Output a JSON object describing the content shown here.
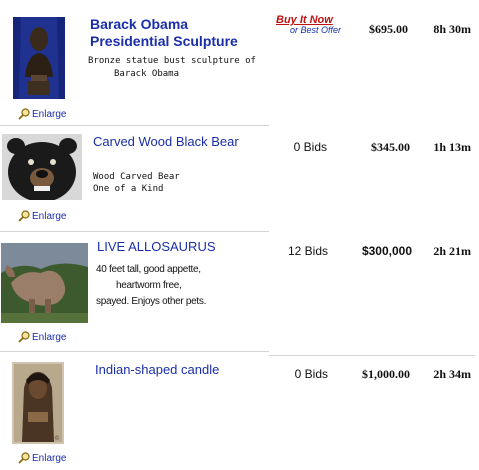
{
  "colors": {
    "link": "#1a2ea8",
    "buy_it_now": "#c01010",
    "divider": "#d4d4d4"
  },
  "listings": [
    {
      "title": "Barack Obama Presidential Sculpture",
      "description_lines": [
        "Bronze statue bust sculpture of",
        "Barack Obama"
      ],
      "format_badge": {
        "main": "Buy It Now",
        "sub": "or Best Offer"
      },
      "bids": "",
      "price": "$695.00",
      "time_left": "8h 30m",
      "enlarge": "Enlarge",
      "image_icon": "bust-photo"
    },
    {
      "title": "Carved Wood Black Bear",
      "description_lines": [
        "Wood Carved Bear",
        "One of a Kind"
      ],
      "bids": "0 Bids",
      "price": "$345.00",
      "time_left": "1h 13m",
      "enlarge": "Enlarge",
      "image_icon": "bear-photo"
    },
    {
      "title": "LIVE ALLOSAURUS",
      "description_lines": [
        "40 feet tall, good appette,",
        "heartworm free,",
        "spayed.  Enjoys other pets."
      ],
      "bids": "12 Bids",
      "price": "$300,000",
      "time_left": "2h 21m",
      "enlarge": "Enlarge",
      "image_icon": "dinosaur-photo"
    },
    {
      "title": "Indian-shaped candle",
      "description_lines": [],
      "bids": "0 Bids",
      "price": "$1,000.00",
      "time_left": "2h 34m",
      "enlarge": "Enlarge",
      "image_icon": "candle-photo"
    }
  ]
}
